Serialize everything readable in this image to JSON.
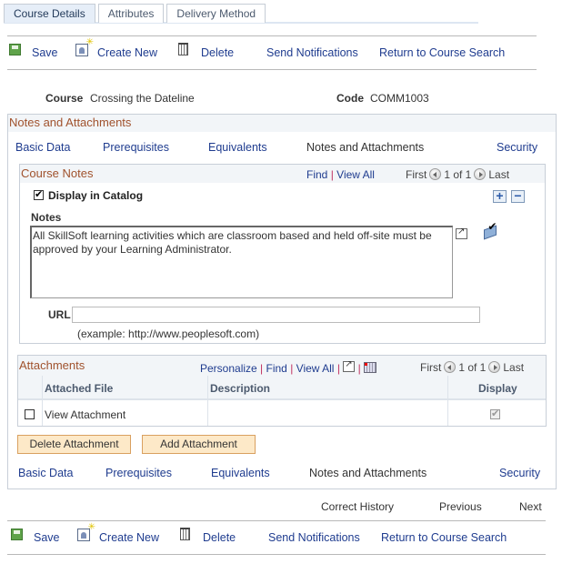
{
  "tabs": [
    {
      "label": "Course Details",
      "active": true
    },
    {
      "label": "Attributes",
      "active": false
    },
    {
      "label": "Delivery Method",
      "active": false
    }
  ],
  "toolbar": {
    "save": "Save",
    "create_new": "Create New",
    "delete": "Delete",
    "send_notifications": "Send Notifications",
    "return_search": "Return to Course Search"
  },
  "course": {
    "course_label": "Course",
    "course_value": "Crossing the Dateline",
    "code_label": "Code",
    "code_value": "COMM1003"
  },
  "section_title": "Notes and Attachments",
  "subnav": [
    "Basic Data",
    "Prerequisites",
    "Equivalents",
    "Notes and Attachments",
    "Security"
  ],
  "subnav_current": "Notes and Attachments",
  "course_notes": {
    "title": "Course Notes",
    "find": "Find",
    "view_all": "View All",
    "first": "First",
    "counter": "1 of 1",
    "last": "Last",
    "display_in_catalog_label": "Display in Catalog",
    "display_in_catalog": true,
    "notes_label": "Notes",
    "notes_value": "All SkillSoft learning activities which are classroom based and held off-site must be approved by your Learning Administrator.",
    "url_label": "URL",
    "url_value": "",
    "url_hint": "(example: http://www.peoplesoft.com)"
  },
  "attachments": {
    "title": "Attachments",
    "personalize": "Personalize",
    "find": "Find",
    "view_all": "View All",
    "first": "First",
    "counter": "1 of 1",
    "last": "Last",
    "columns": [
      "Attached File",
      "Description",
      "Display"
    ],
    "rows": [
      {
        "selected": false,
        "file": "View Attachment",
        "description": "",
        "display": true
      }
    ],
    "delete_button": "Delete Attachment",
    "add_button": "Add Attachment"
  },
  "footer_nav": {
    "correct_history": "Correct History",
    "previous": "Previous",
    "next": "Next"
  },
  "colors": {
    "link": "#1f3c8f",
    "section_title": "#a0522d",
    "button_bg": "#fde9c8"
  }
}
